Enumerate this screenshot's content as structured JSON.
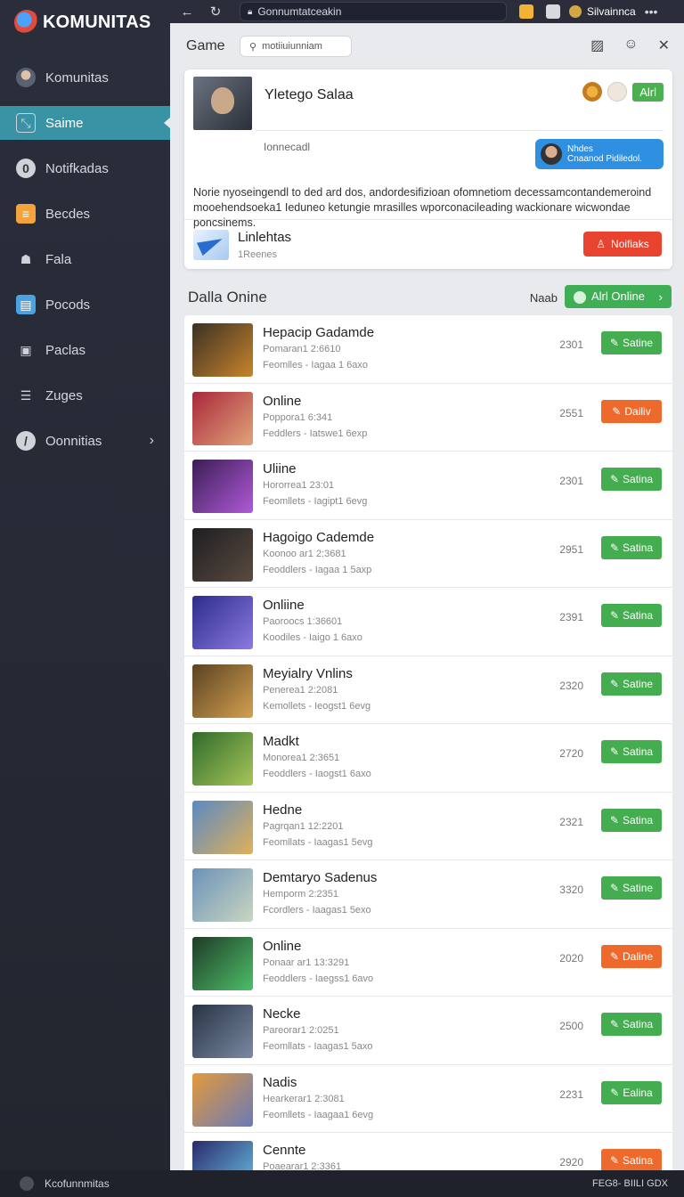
{
  "brand": "KOMUNITAS",
  "sidebar": {
    "items": [
      {
        "label": "Komunitas",
        "icon": "avatar-icon"
      },
      {
        "label": "Saime",
        "icon": "chart-icon",
        "active": true
      },
      {
        "label": "Notifkadas",
        "icon": "notification-icon"
      },
      {
        "label": "Becdes",
        "icon": "folder-icon"
      },
      {
        "label": "Fala",
        "icon": "people-icon"
      },
      {
        "label": "Pocods",
        "icon": "calendar-icon"
      },
      {
        "label": "Paclas",
        "icon": "briefcase-icon"
      },
      {
        "label": "Zuges",
        "icon": "list-icon"
      },
      {
        "label": "Oonnitias",
        "icon": "settings-icon"
      }
    ]
  },
  "browser": {
    "url": "Gonnumtatceakin",
    "user": "Silvainnca",
    "more": "•••"
  },
  "header": {
    "title": "Game",
    "search_value": "motiiuiunniam"
  },
  "profile": {
    "name": "Yletego Salaa",
    "subtitle": "Ionnecadl",
    "badge": "Alrl",
    "notify_line1": "Nhdes",
    "notify_line2": "Cnaanod Pidiledol.",
    "description": "Norie nyoseingendl to ded ard dos, andordesifizioan ofomnetiom decessamcontandemeroind mooehendsoeka1 Ieduneo ketungie mrasilles wporconacileading wackionare wicwondae poncsinems.",
    "link_title": "Linlehtas",
    "link_sub": "1Reenes",
    "notif_button": "Noifiaks"
  },
  "section": {
    "title": "Dalla Onine",
    "label": "Naab",
    "button": "Alrl Online"
  },
  "rows": [
    {
      "title": "Hepacip Gadamde",
      "sub1": "Pomaran1 2:6610",
      "sub2": "Feomlles  -  Iagaa 1 6axo",
      "num": "2301",
      "btn": "Satine",
      "color": "green",
      "c1": "#3b3025",
      "c2": "#c8852a"
    },
    {
      "title": "Online",
      "sub1": "Poppora1 6:341",
      "sub2": "Feddlers  -  Iatswe1 6exp",
      "num": "2551",
      "btn": "Dailiv",
      "color": "orange",
      "c1": "#a8283a",
      "c2": "#e2a47a"
    },
    {
      "title": "Uliine",
      "sub1": "Hororrea1 23:01",
      "sub2": "Feomllets  -  Iagipt1 6evg",
      "num": "2301",
      "btn": "Satina",
      "color": "green",
      "c1": "#3a1d55",
      "c2": "#b05ad8"
    },
    {
      "title": "Hagoigo Cademde",
      "sub1": "Koonoo ar1 2:3681",
      "sub2": "Feoddlers  -  Iagaa 1 5axp",
      "num": "2951",
      "btn": "Satina",
      "color": "green",
      "c1": "#1e1e22",
      "c2": "#5a4b40"
    },
    {
      "title": "Onliine",
      "sub1": "Paoroocs 1:36601",
      "sub2": "Koodiles  -  Iaigo 1 6axo",
      "num": "2391",
      "btn": "Satina",
      "color": "green",
      "c1": "#2b2c8a",
      "c2": "#8c7ae0"
    },
    {
      "title": "Meyialry Vnlins",
      "sub1": "Penerea1 2:2081",
      "sub2": "Kemollets  -  Ieogst1 6evg",
      "num": "2320",
      "btn": "Satine",
      "color": "green",
      "c1": "#5a4222",
      "c2": "#d4a050"
    },
    {
      "title": "Madkt",
      "sub1": "Monorea1 2:3651",
      "sub2": "Feoddlers  -  Iaogst1 6axo",
      "num": "2720",
      "btn": "Satina",
      "color": "green",
      "c1": "#2f6a2a",
      "c2": "#a7c65a"
    },
    {
      "title": "Hedne",
      "sub1": "Pagrqan1 12:2201",
      "sub2": "Feomllats  -  Iaagas1 5evg",
      "num": "2321",
      "btn": "Satina",
      "color": "green",
      "c1": "#5a8ac2",
      "c2": "#e0b05a"
    },
    {
      "title": "Demtaryo Sadenus",
      "sub1": "Hemporm 2:2351",
      "sub2": "Fcordlers  -  Iaagas1 5exo",
      "num": "3320",
      "btn": "Satine",
      "color": "green",
      "c1": "#6b92b8",
      "c2": "#c9d6c2"
    },
    {
      "title": "Online",
      "sub1": "Ponaar ar1 13:3291",
      "sub2": "Feoddlers  -  Iaegss1 6avo",
      "num": "2020",
      "btn": "Daline",
      "color": "orange",
      "c1": "#1f3a26",
      "c2": "#4dbf6a"
    },
    {
      "title": "Necke",
      "sub1": "Pareorar1 2:0251",
      "sub2": "Feomllats  -  Iaagas1 5axo",
      "num": "2500",
      "btn": "Satina",
      "color": "green",
      "c1": "#283244",
      "c2": "#7a8aa2"
    },
    {
      "title": "Nadis",
      "sub1": "Hearkerar1 2:3081",
      "sub2": "Feomllets  -  Iaagaa1 6evg",
      "num": "2231",
      "btn": "Ealina",
      "color": "green",
      "c1": "#e39a3a",
      "c2": "#6a7ab8"
    },
    {
      "title": "Cennte",
      "sub1": "Poaearar1 2:3361",
      "sub2": "",
      "num": "2920",
      "btn": "Satina",
      "color": "orange",
      "c1": "#2a2a6a",
      "c2": "#6ac3e8"
    }
  ],
  "statusbar": {
    "label": "Kcofunnmitas",
    "right": "FEG8-   BIILI  GDX"
  }
}
